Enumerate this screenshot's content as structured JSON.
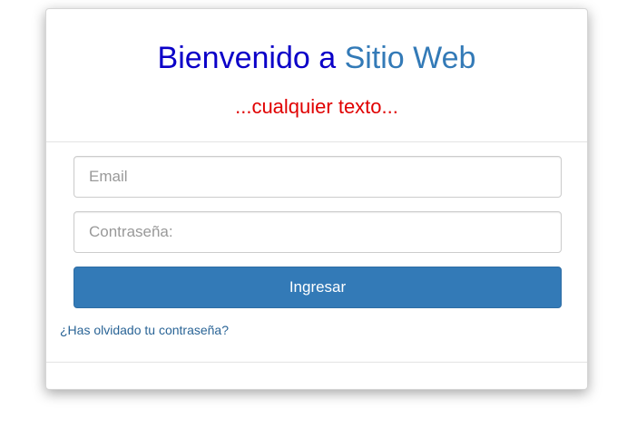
{
  "header": {
    "title_main": "Bienvenido a",
    "title_site": "Sitio Web",
    "subtitle": "...cualquier texto..."
  },
  "form": {
    "email_placeholder": "Email",
    "email_value": "",
    "password_placeholder": "Contraseña:",
    "password_value": "",
    "submit_label": "Ingresar",
    "forgot_label": "¿Has olvidado tu contraseña?"
  },
  "colors": {
    "title_main": "#0b00c8",
    "title_site": "#337ab7",
    "subtitle": "#e00000",
    "button": "#337ab7",
    "link": "#2a6496"
  }
}
